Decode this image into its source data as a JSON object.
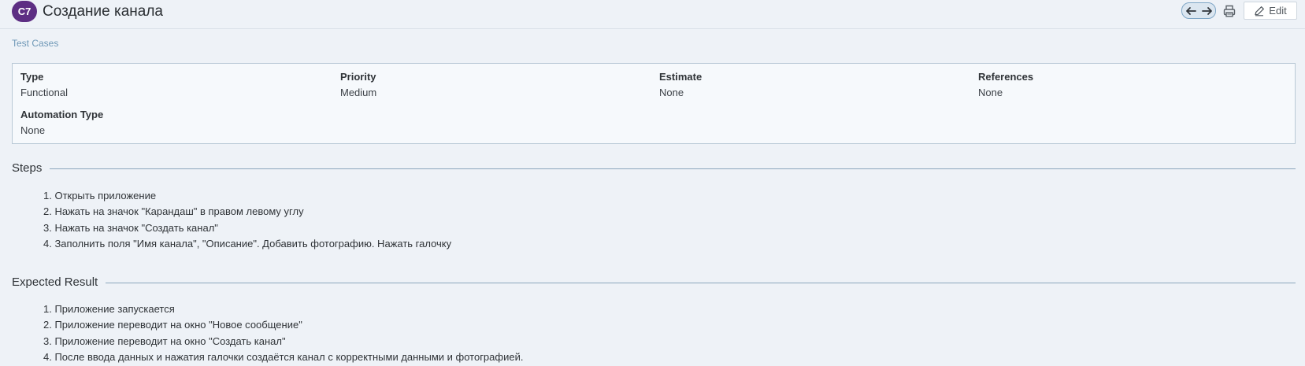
{
  "header": {
    "case_id": "C7",
    "title": "Создание канала",
    "edit_label": "Edit",
    "icons": {
      "previous": "arrow-left-icon",
      "next": "arrow-right-icon",
      "print": "printer-icon",
      "edit": "pencil-icon"
    }
  },
  "breadcrumb": {
    "label": "Test Cases"
  },
  "fields": {
    "type": {
      "label": "Type",
      "value": "Functional"
    },
    "priority": {
      "label": "Priority",
      "value": "Medium"
    },
    "estimate": {
      "label": "Estimate",
      "value": "None"
    },
    "references": {
      "label": "References",
      "value": "None"
    },
    "automation_type": {
      "label": "Automation Type",
      "value": "None"
    }
  },
  "steps": {
    "title": "Steps",
    "items": [
      "1. Открыть приложение",
      "2. Нажать на значок \"Карандаш\" в правом левому углу",
      "3. Нажать на значок \"Создать канал\"",
      "4. Заполнить поля \"Имя канала\", \"Описание\". Добавить фотографию. Нажать галочку"
    ]
  },
  "expected_result": {
    "title": "Expected Result",
    "items": [
      "1. Приложение запускается",
      "2. Приложение переводит на окно \"Новое сообщение\"",
      "3. Приложение переводит на окно \"Создать канал\"",
      "4. После ввода данных и нажатия галочки создаётся канал с корректными данными и фотографией."
    ]
  },
  "colors": {
    "page_background": "#eef2f7",
    "badge_background": "#5d2e83",
    "link": "#6f98b7",
    "panel_border": "#b9c9d6",
    "rule": "#8ca6bc"
  }
}
